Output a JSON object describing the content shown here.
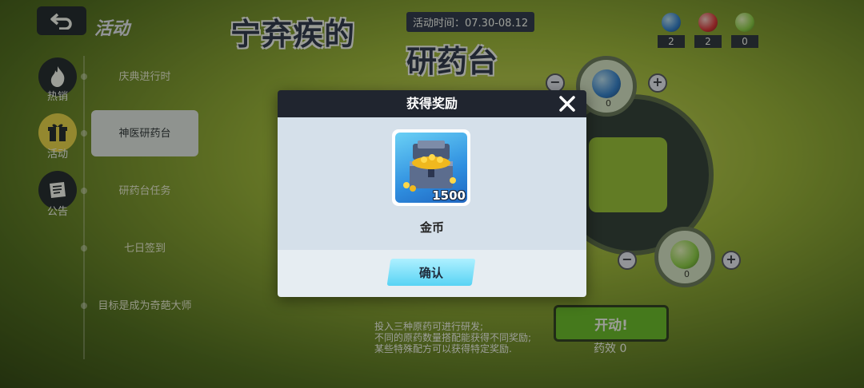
{
  "header": {
    "back_icon": "back-arrow-icon",
    "title": "活动"
  },
  "rail": [
    {
      "label": "热销",
      "icon": "flame-icon"
    },
    {
      "label": "活动",
      "icon": "gift-icon"
    },
    {
      "label": "公告",
      "icon": "notice-icon"
    }
  ],
  "menu": [
    {
      "label": "庆典进行时"
    },
    {
      "label": "神医研药台"
    },
    {
      "label": "研药台任务"
    },
    {
      "label": "七日签到"
    },
    {
      "label": "目标是成为奇葩大师"
    }
  ],
  "banner": {
    "title_line1": "宁弃疾的",
    "title_line2": "研药台",
    "time": "活动时间：07.30-08.12"
  },
  "resources": [
    {
      "color": "#2f7fd8",
      "count": "2"
    },
    {
      "color": "#e0303a",
      "count": "2"
    },
    {
      "color": "#8fd24a",
      "count": "0"
    }
  ],
  "machine": {
    "slot_top_count": "0",
    "slot_bottom_count": "0",
    "start_label": "开动!",
    "efficacy": "药效 0"
  },
  "description": [
    "投入三种原药可进行研发;",
    "不同的原药数量搭配能获得不同奖励;",
    "某些特殊配方可以获得特定奖励."
  ],
  "dialog": {
    "title": "获得奖励",
    "item_name": "金币",
    "item_quantity": "1500",
    "confirm_label": "确认"
  },
  "colors": {
    "accent": "#58d3f4",
    "dialog_header": "#20252f",
    "dialog_body": "#d5e0ea"
  }
}
